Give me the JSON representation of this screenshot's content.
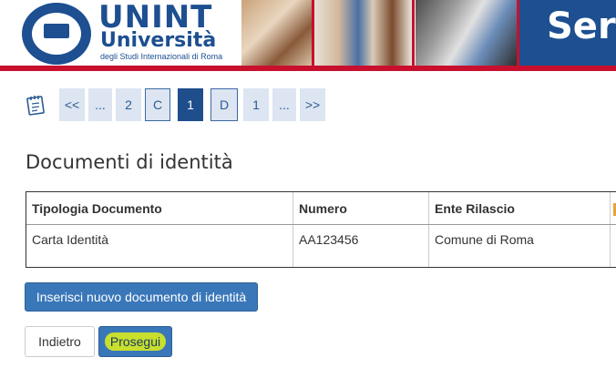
{
  "header": {
    "brand_main": "UNINT",
    "brand_university": "Università",
    "brand_sub": "degli Studi Internazionali di Roma",
    "seal_text": "Università degli Studi Internazionali",
    "banner_text": "Ser",
    "colors": {
      "brand_blue": "#1d4f91",
      "brand_red": "#c8102e"
    }
  },
  "pager": {
    "icon": "notepad-icon",
    "items": [
      "<<",
      "...",
      "2",
      "C",
      "1",
      "D",
      "1",
      "...",
      ">>"
    ]
  },
  "section": {
    "title": "Documenti di identità"
  },
  "table": {
    "headers": [
      "Tipologia Documento",
      "Numero",
      "Ente Rilascio"
    ],
    "rows": [
      [
        "Carta Identità",
        "AA123456",
        "Comune di Roma"
      ]
    ]
  },
  "actions": {
    "add_document": "Inserisci nuovo documento di identità",
    "back": "Indietro",
    "next": "Prosegui"
  }
}
